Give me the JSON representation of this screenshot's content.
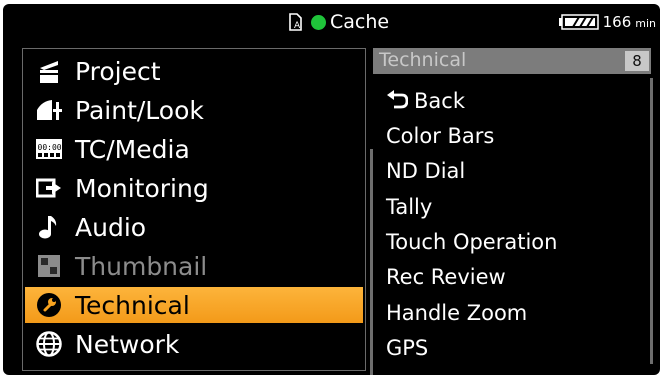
{
  "status": {
    "media_label": "Cache",
    "battery_value": "166",
    "battery_unit": "min",
    "rec_color": "#1fc43a"
  },
  "menu": {
    "items": [
      {
        "label": "Project",
        "icon": "project-icon"
      },
      {
        "label": "Paint/Look",
        "icon": "paint-look-icon"
      },
      {
        "label": "TC/Media",
        "icon": "tc-media-icon"
      },
      {
        "label": "Monitoring",
        "icon": "monitoring-icon"
      },
      {
        "label": "Audio",
        "icon": "audio-icon"
      },
      {
        "label": "Thumbnail",
        "icon": "thumbnail-icon",
        "state": "disabled"
      },
      {
        "label": "Technical",
        "icon": "technical-icon",
        "state": "selected"
      },
      {
        "label": "Network",
        "icon": "network-icon"
      }
    ],
    "selected_color": "#f7a21f"
  },
  "submenu": {
    "title": "Technical",
    "count": "8",
    "items": [
      {
        "label": "Back",
        "icon": "back-arrow-icon"
      },
      {
        "label": "Color Bars"
      },
      {
        "label": "ND Dial"
      },
      {
        "label": "Tally"
      },
      {
        "label": "Touch Operation"
      },
      {
        "label": "Rec Review"
      },
      {
        "label": "Handle Zoom"
      },
      {
        "label": "GPS"
      }
    ]
  }
}
